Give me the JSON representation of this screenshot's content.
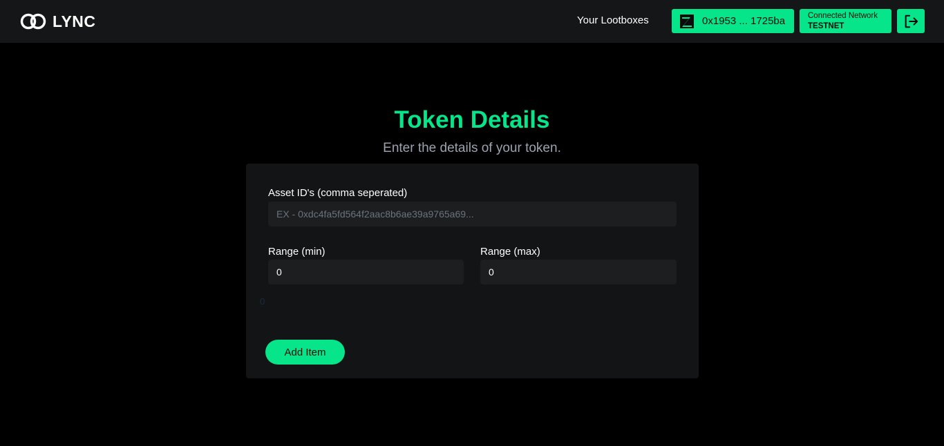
{
  "header": {
    "brand": "LYNC",
    "nav_link": "Your Lootboxes",
    "wallet_address": "0x1953 ... 1725ba",
    "network_label": "Connected Network",
    "network_value": "TESTNET"
  },
  "page": {
    "title": "Token Details",
    "subtitle": "Enter the details of your token."
  },
  "form": {
    "asset_ids_label": "Asset ID's (comma seperated)",
    "asset_ids_placeholder": "EX - 0xdc4fa5fd564f2aac8b6ae39a9765a69...",
    "asset_ids_value": "",
    "range_min_label": "Range (min)",
    "range_min_value": "0",
    "range_max_label": "Range (max)",
    "range_max_value": "0",
    "stray_value": "0",
    "add_button_label": "Add Item"
  },
  "colors": {
    "accent": "#06e58a",
    "background": "#000000",
    "header_bg": "#151617",
    "card_bg": "#131415",
    "input_bg": "#1c1e20",
    "muted_text": "#9ca3af"
  }
}
